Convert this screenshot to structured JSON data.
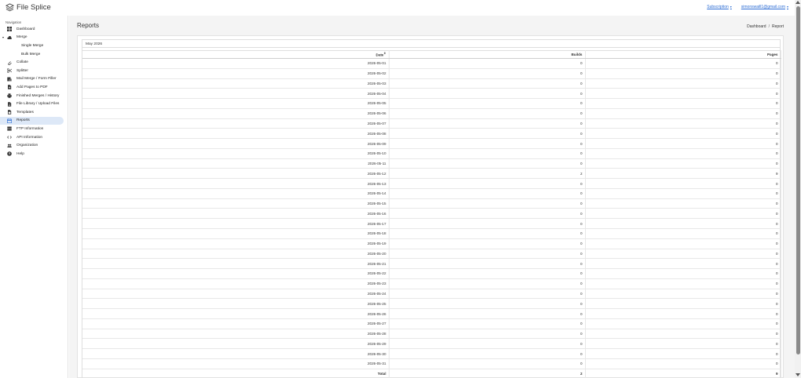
{
  "app": {
    "name": "File Splice",
    "logo_icon": "stack-layers-icon"
  },
  "topnav": {
    "subscription": "Subscription",
    "account": "simonswaill1@gmail.com"
  },
  "sidebar": {
    "heading": "Navigation",
    "items": [
      {
        "label": "Dashboard",
        "icon": "grid-icon"
      },
      {
        "label": "Merge",
        "icon": "cloud-upload-icon"
      },
      {
        "label": "Single Merge",
        "icon": ""
      },
      {
        "label": "Bulk Merge",
        "icon": ""
      },
      {
        "label": "Collate",
        "icon": "paperclip-icon"
      },
      {
        "label": "Splitter",
        "icon": "scissors-icon"
      },
      {
        "label": "Mail Merge / Form Filler",
        "icon": "mail-merge-icon"
      },
      {
        "label": "Add Pages to PDF",
        "icon": "file-plus-icon"
      },
      {
        "label": "Finished Merges / History",
        "icon": "printer-icon"
      },
      {
        "label": "File Library / Upload Files",
        "icon": "file-library-icon"
      },
      {
        "label": "Templates",
        "icon": "file-template-icon"
      },
      {
        "label": "Reports",
        "icon": "calendar-icon"
      },
      {
        "label": "FTP Information",
        "icon": "server-icon"
      },
      {
        "label": "API Information",
        "icon": "code-icon"
      },
      {
        "label": "Organization",
        "icon": "users-icon"
      },
      {
        "label": "Help",
        "icon": "question-icon"
      }
    ]
  },
  "main": {
    "title": "Reports",
    "breadcrumb": {
      "home": "Dashboard",
      "separator": "/",
      "current": "Report"
    },
    "panel_title": "May 2026",
    "columns": [
      "Date",
      "Builds",
      "Pages"
    ],
    "sort_indicator": "⬍",
    "rows": [
      [
        "2026-05-01",
        "0",
        "0"
      ],
      [
        "2026-05-02",
        "0",
        "0"
      ],
      [
        "2026-05-03",
        "0",
        "0"
      ],
      [
        "2026-05-04",
        "0",
        "0"
      ],
      [
        "2026-05-05",
        "0",
        "0"
      ],
      [
        "2026-05-06",
        "0",
        "0"
      ],
      [
        "2026-05-07",
        "0",
        "0"
      ],
      [
        "2026-05-08",
        "0",
        "0"
      ],
      [
        "2026-05-09",
        "0",
        "0"
      ],
      [
        "2026-05-10",
        "0",
        "0"
      ],
      [
        "2026-05-11",
        "0",
        "0"
      ],
      [
        "2026-05-12",
        "2",
        "9"
      ],
      [
        "2026-05-13",
        "0",
        "0"
      ],
      [
        "2026-05-14",
        "0",
        "0"
      ],
      [
        "2026-05-15",
        "0",
        "0"
      ],
      [
        "2026-05-16",
        "0",
        "0"
      ],
      [
        "2026-05-17",
        "0",
        "0"
      ],
      [
        "2026-05-18",
        "0",
        "0"
      ],
      [
        "2026-05-19",
        "0",
        "0"
      ],
      [
        "2026-05-20",
        "0",
        "0"
      ],
      [
        "2026-05-21",
        "0",
        "0"
      ],
      [
        "2026-05-22",
        "0",
        "0"
      ],
      [
        "2026-05-23",
        "0",
        "0"
      ],
      [
        "2026-05-24",
        "0",
        "0"
      ],
      [
        "2026-05-25",
        "0",
        "0"
      ],
      [
        "2026-05-26",
        "0",
        "0"
      ],
      [
        "2026-05-27",
        "0",
        "0"
      ],
      [
        "2026-05-28",
        "0",
        "0"
      ],
      [
        "2026-05-29",
        "0",
        "0"
      ],
      [
        "2026-05-30",
        "0",
        "0"
      ],
      [
        "2026-05-31",
        "0",
        "0"
      ]
    ],
    "total": [
      "Total",
      "2",
      "9"
    ]
  },
  "colors": {
    "link": "#2b6cd4",
    "active_nav_bg": "#dde8f7",
    "main_bg": "#f4f4f4"
  }
}
